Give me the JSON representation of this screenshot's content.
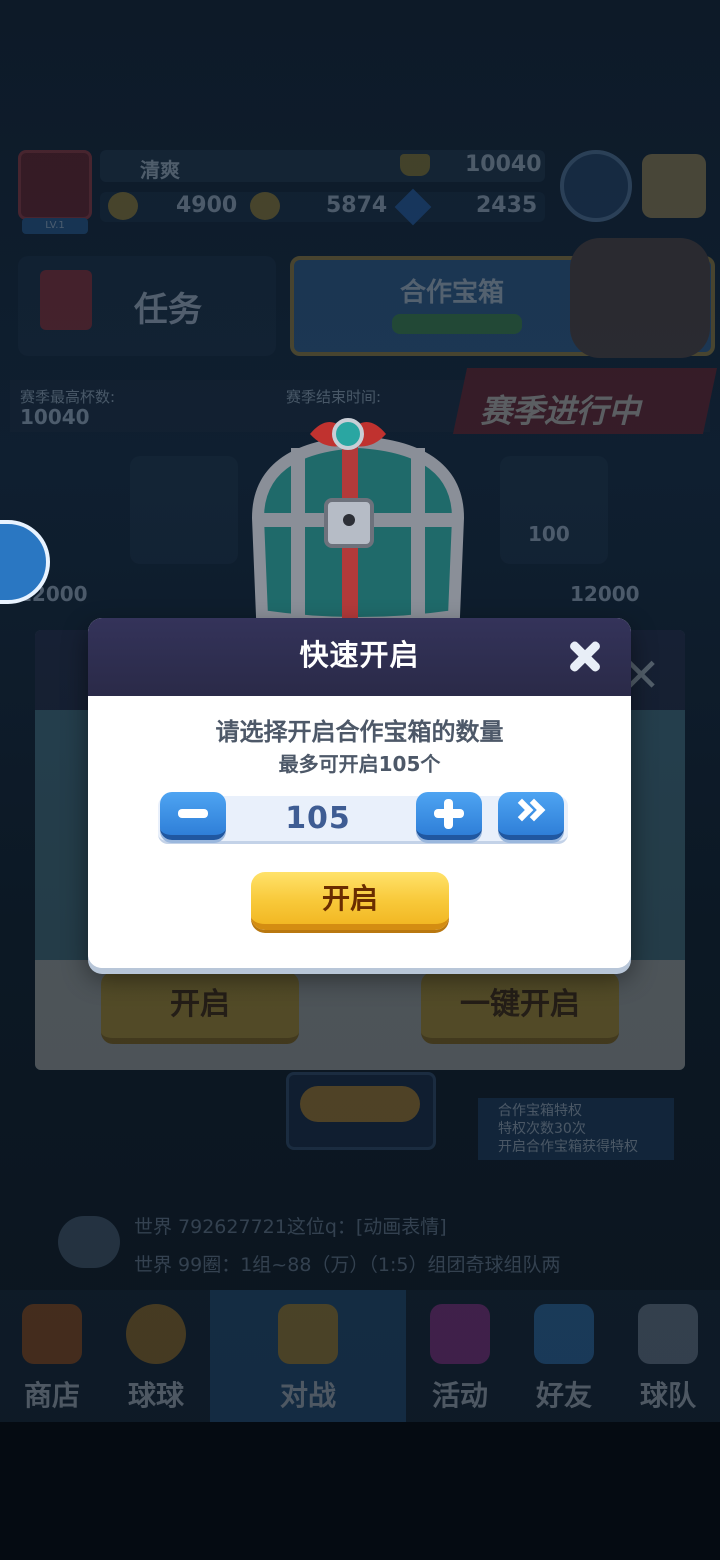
{
  "background": {
    "player": {
      "name": "清爽",
      "score": "10040",
      "avatar_tag": "LV.1"
    },
    "resources": [
      {
        "icon": "coin-icon",
        "value": "4900"
      },
      {
        "icon": "gold-icon",
        "value": "5874"
      },
      {
        "icon": "gem-icon",
        "value": "2435"
      }
    ],
    "task_label": "任务",
    "coop_chest_label": "合作宝箱",
    "season": {
      "label_left": "赛季最高杯数:",
      "value_left": "10040",
      "label_right": "赛季结束时间:",
      "banner": "赛季进行中"
    },
    "rewards": [
      "100",
      "12000",
      "12000"
    ],
    "under_buttons": {
      "open": "开启",
      "one_click_open": "一键开启"
    },
    "rights_lines": [
      "合作宝箱特权",
      "特权次数30次",
      "开启合作宝箱获得特权"
    ],
    "chat_lines": [
      "世界  792627721这位q：[动画表情]",
      "世界  99圈：1组~88（万）（1:5）组团奇球组队两"
    ],
    "nav": [
      "商店",
      "球球",
      "对战",
      "活动",
      "好友",
      "球队"
    ]
  },
  "modal": {
    "title": "快速开启",
    "instruction": "请选择开启合作宝箱的数量",
    "max_text": "最多可开启105个",
    "quantity": "105",
    "open_label": "开启"
  },
  "colors": {
    "modal_header": "#2a2a48",
    "step_button": "#2f7fd8",
    "open_button": "#f8c93a",
    "quantity_text": "#3e5c93"
  }
}
